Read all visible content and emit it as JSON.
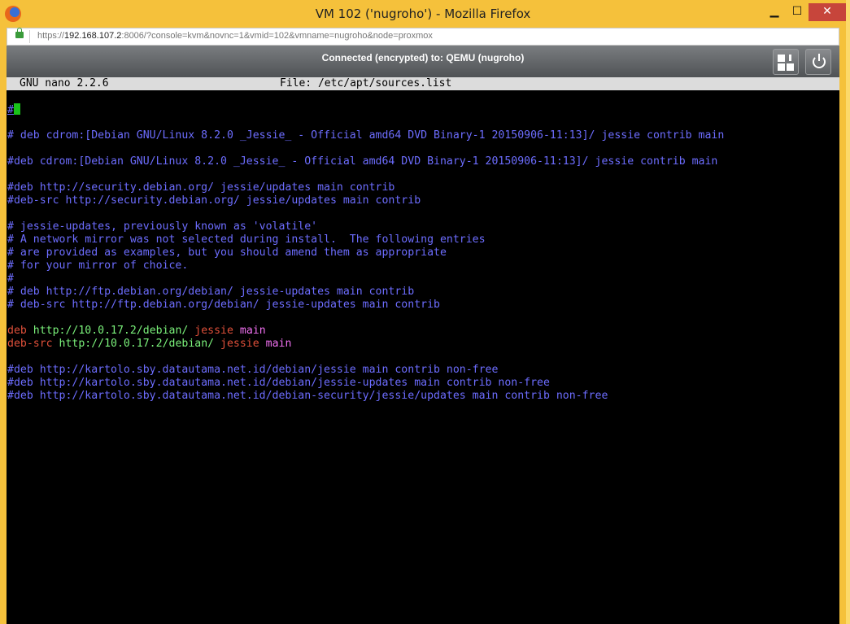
{
  "window": {
    "title": "VM 102 ('nugroho') - Mozilla Firefox",
    "minimize": "▁",
    "maximize": "☐",
    "close": "✕"
  },
  "browser": {
    "url_prefix": "https://",
    "url_host": "192.168.107.2",
    "url_rest": ":8006/?console=kvm&novnc=1&vmid=102&vmname=nugroho&node=proxmox"
  },
  "proxmox": {
    "status": "Connected (encrypted) to: QEMU (nugroho)",
    "keys_button_icon": "send-keys-icon",
    "power_button_icon": "power-icon"
  },
  "nano": {
    "version": "GNU nano 2.2.6",
    "file": "File: /etc/apt/sources.list"
  },
  "lines": [
    {
      "type": "cursor",
      "text": "#"
    },
    {
      "type": "blank",
      "text": ""
    },
    {
      "type": "plain",
      "text": "# deb cdrom:[Debian GNU/Linux 8.2.0 _Jessie_ - Official amd64 DVD Binary-1 20150906-11:13]/ jessie contrib main"
    },
    {
      "type": "blank",
      "text": ""
    },
    {
      "type": "plain",
      "text": "#deb cdrom:[Debian GNU/Linux 8.2.0 _Jessie_ - Official amd64 DVD Binary-1 20150906-11:13]/ jessie contrib main"
    },
    {
      "type": "blank",
      "text": ""
    },
    {
      "type": "plain",
      "text": "#deb http://security.debian.org/ jessie/updates main contrib"
    },
    {
      "type": "plain",
      "text": "#deb-src http://security.debian.org/ jessie/updates main contrib"
    },
    {
      "type": "blank",
      "text": ""
    },
    {
      "type": "plain",
      "text": "# jessie-updates, previously known as 'volatile'"
    },
    {
      "type": "plain",
      "text": "# A network mirror was not selected during install.  The following entries"
    },
    {
      "type": "plain",
      "text": "# are provided as examples, but you should amend them as appropriate"
    },
    {
      "type": "plain",
      "text": "# for your mirror of choice."
    },
    {
      "type": "plain",
      "text": "#"
    },
    {
      "type": "plain",
      "text": "# deb http://ftp.debian.org/debian/ jessie-updates main contrib"
    },
    {
      "type": "plain",
      "text": "# deb-src http://ftp.debian.org/debian/ jessie-updates main contrib"
    },
    {
      "type": "blank",
      "text": ""
    },
    {
      "type": "source",
      "kw": "deb",
      "url": "http://10.0.17.2/debian/",
      "dist": "jessie",
      "comp": "main"
    },
    {
      "type": "source",
      "kw": "deb-src",
      "url": "http://10.0.17.2/debian/",
      "dist": "jessie",
      "comp": "main"
    },
    {
      "type": "blank",
      "text": ""
    },
    {
      "type": "plain",
      "text": "#deb http://kartolo.sby.datautama.net.id/debian/jessie main contrib non-free"
    },
    {
      "type": "plain",
      "text": "#deb http://kartolo.sby.datautama.net.id/debian/jessie-updates main contrib non-free"
    },
    {
      "type": "plain",
      "text": "#deb http://kartolo.sby.datautama.net.id/debian-security/jessie/updates main contrib non-free"
    }
  ]
}
